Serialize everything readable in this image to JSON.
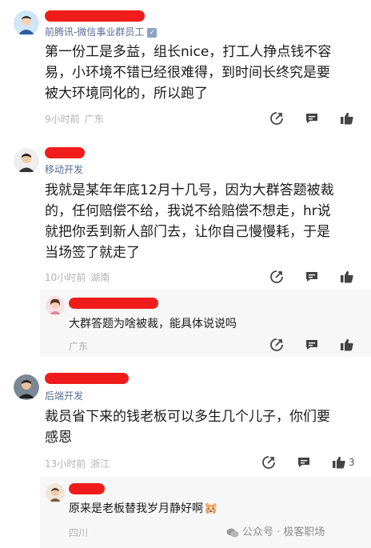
{
  "comments": [
    {
      "role": "前腾讯-微信事业群员工",
      "text_lines": [
        "第一份工是多益，组长nice，打工人挣点钱不容",
        "易，小环境不错已经很难得，到时间长终究是要",
        "被大环境同化的，所以跑了"
      ],
      "time": "9小时前",
      "location": "广东"
    },
    {
      "role": "移动开发",
      "text_lines": [
        "我就是某年年底12月十几号，因为大群答题被裁",
        "的，任何赔偿不给，我说不给赔偿不想走，hr说",
        "就把你丢到新人部门去，让你自己慢慢耗，于是",
        "当场签了就走了"
      ],
      "time": "10小时前",
      "location": "湖南",
      "reply": {
        "text": "大群答题为啥被裁，能具体说说吗",
        "location": "广东"
      }
    },
    {
      "role": "后端开发",
      "text_lines": [
        "裁员省下来的钱老板可以多生几个儿子，你们要",
        "感恩"
      ],
      "time": "13小时前",
      "location": "浙江",
      "likes": "3",
      "reply": {
        "text": "原来是老板替我岁月静好啊",
        "emoji": "🐹",
        "location": "四川"
      }
    }
  ],
  "watermark": "公众号 · 极客职场",
  "colors": {
    "redaction": "#f01c1c",
    "role": "#576b95",
    "meta": "#b2b2b2",
    "icon": "#444444"
  }
}
